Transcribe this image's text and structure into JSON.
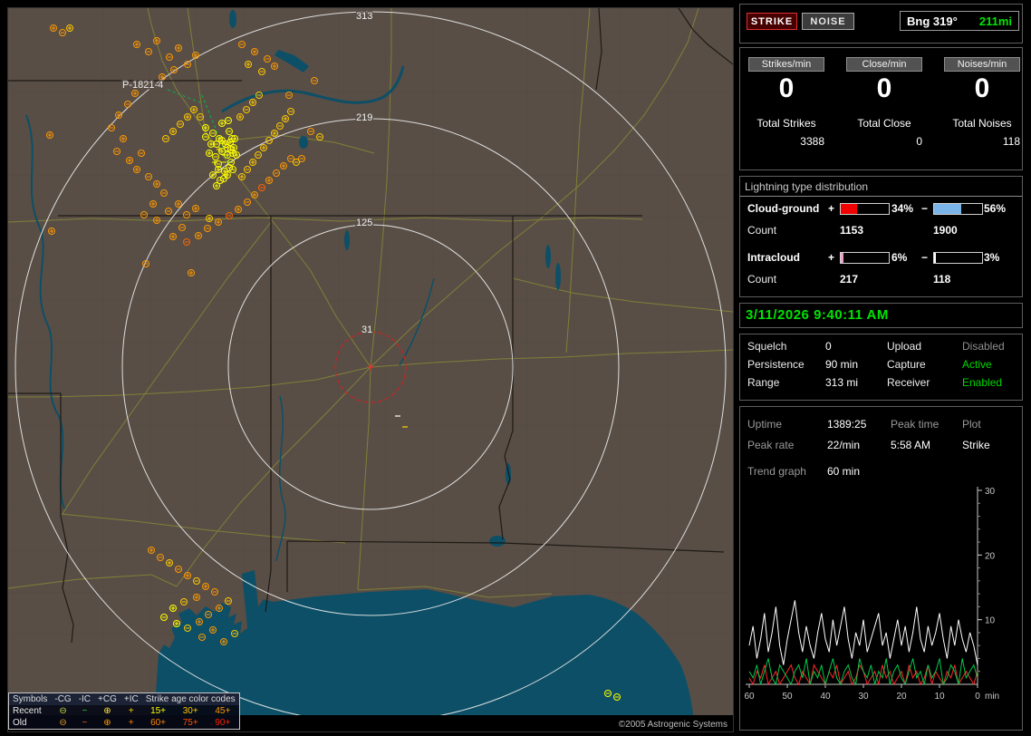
{
  "app": {
    "copyright": "©2005 Astrogenic Systems"
  },
  "map": {
    "station_label": "P-1821-4",
    "range_labels": [
      "313",
      "219",
      "125",
      "31"
    ],
    "strike_colors": [
      "#ffff00",
      "#ffc800",
      "#ff9800",
      "#ff6400"
    ],
    "strikes": [
      [
        218,
        132,
        0,
        "p"
      ],
      [
        226,
        138,
        0,
        "m"
      ],
      [
        233,
        144,
        0,
        "p"
      ],
      [
        240,
        150,
        0,
        "p"
      ],
      [
        247,
        144,
        0,
        "m"
      ],
      [
        236,
        158,
        0,
        "p"
      ],
      [
        229,
        164,
        0,
        "m"
      ],
      [
        242,
        162,
        0,
        "p"
      ],
      [
        249,
        154,
        0,
        "p"
      ],
      [
        224,
        150,
        0,
        "p"
      ],
      [
        232,
        172,
        0,
        "m"
      ],
      [
        239,
        180,
        0,
        "p"
      ],
      [
        246,
        170,
        0,
        "m"
      ],
      [
        252,
        162,
        0,
        "p"
      ],
      [
        226,
        184,
        0,
        "p"
      ],
      [
        234,
        190,
        0,
        "m"
      ],
      [
        242,
        184,
        0,
        "p"
      ],
      [
        248,
        178,
        0,
        "m"
      ],
      [
        230,
        196,
        0,
        "p"
      ],
      [
        238,
        188,
        0,
        "m"
      ],
      [
        222,
        160,
        0,
        "p"
      ],
      [
        244,
        136,
        0,
        "m"
      ],
      [
        250,
        144,
        0,
        "p"
      ],
      [
        218,
        142,
        0,
        "m"
      ],
      [
        236,
        127,
        0,
        "p"
      ],
      [
        243,
        124,
        0,
        "m"
      ],
      [
        230,
        150,
        0,
        "m"
      ],
      [
        236,
        146,
        0,
        "p"
      ],
      [
        242,
        154,
        0,
        "m"
      ],
      [
        248,
        160,
        0,
        "p"
      ],
      [
        233,
        156,
        0,
        "+"
      ],
      [
        239,
        162,
        0,
        "-"
      ],
      [
        245,
        148,
        0,
        "p"
      ],
      [
        228,
        170,
        0,
        "+"
      ],
      [
        244,
        176,
        0,
        "m"
      ],
      [
        238,
        170,
        0,
        "-"
      ],
      [
        232,
        178,
        0,
        "p"
      ],
      [
        246,
        156,
        0,
        "m"
      ],
      [
        205,
        112,
        1,
        "p"
      ],
      [
        212,
        120,
        1,
        "m"
      ],
      [
        198,
        120,
        1,
        "p"
      ],
      [
        190,
        128,
        1,
        "m"
      ],
      [
        182,
        136,
        1,
        "p"
      ],
      [
        174,
        144,
        1,
        "m"
      ],
      [
        256,
        120,
        1,
        "p"
      ],
      [
        263,
        112,
        1,
        "m"
      ],
      [
        270,
        104,
        1,
        "p"
      ],
      [
        277,
        96,
        1,
        "m"
      ],
      [
        258,
        186,
        1,
        "p"
      ],
      [
        264,
        178,
        1,
        "m"
      ],
      [
        270,
        170,
        1,
        "p"
      ],
      [
        276,
        162,
        1,
        "m"
      ],
      [
        282,
        154,
        1,
        "p"
      ],
      [
        288,
        146,
        1,
        "m"
      ],
      [
        294,
        138,
        1,
        "p"
      ],
      [
        300,
        130,
        1,
        "m"
      ],
      [
        306,
        122,
        1,
        "p"
      ],
      [
        312,
        114,
        1,
        "m"
      ],
      [
        265,
        62,
        1,
        "p"
      ],
      [
        280,
        70,
        1,
        "m"
      ],
      [
        344,
        142,
        1,
        "m"
      ],
      [
        222,
        232,
        1,
        "p"
      ],
      [
        318,
        170,
        1,
        "m"
      ],
      [
        142,
        40,
        2,
        "p"
      ],
      [
        155,
        48,
        2,
        "m"
      ],
      [
        164,
        36,
        2,
        "p"
      ],
      [
        178,
        54,
        2,
        "m"
      ],
      [
        188,
        44,
        2,
        "p"
      ],
      [
        198,
        62,
        2,
        "m"
      ],
      [
        207,
        52,
        2,
        "p"
      ],
      [
        183,
        68,
        2,
        "m"
      ],
      [
        170,
        76,
        2,
        "p"
      ],
      [
        152,
        84,
        2,
        "m"
      ],
      [
        140,
        94,
        2,
        "p"
      ],
      [
        132,
        106,
        2,
        "m"
      ],
      [
        122,
        118,
        2,
        "p"
      ],
      [
        114,
        132,
        2,
        "m"
      ],
      [
        127,
        144,
        2,
        "p"
      ],
      [
        120,
        158,
        2,
        "m"
      ],
      [
        134,
        168,
        2,
        "p"
      ],
      [
        147,
        160,
        2,
        "m"
      ],
      [
        142,
        178,
        2,
        "p"
      ],
      [
        155,
        186,
        2,
        "m"
      ],
      [
        164,
        194,
        2,
        "p"
      ],
      [
        172,
        204,
        2,
        "m"
      ],
      [
        160,
        216,
        2,
        "p"
      ],
      [
        150,
        228,
        2,
        "m"
      ],
      [
        164,
        234,
        2,
        "p"
      ],
      [
        177,
        224,
        2,
        "m"
      ],
      [
        188,
        216,
        2,
        "p"
      ],
      [
        197,
        228,
        2,
        "m"
      ],
      [
        207,
        221,
        2,
        "p"
      ],
      [
        192,
        242,
        2,
        "m"
      ],
      [
        258,
        40,
        2,
        "m"
      ],
      [
        272,
        48,
        2,
        "p"
      ],
      [
        286,
        56,
        2,
        "m"
      ],
      [
        294,
        64,
        2,
        "p"
      ],
      [
        310,
        96,
        2,
        "m"
      ],
      [
        182,
        252,
        2,
        "p"
      ],
      [
        197,
        258,
        3,
        "m"
      ],
      [
        210,
        251,
        2,
        "p"
      ],
      [
        220,
        243,
        2,
        "m"
      ],
      [
        232,
        236,
        2,
        "p"
      ],
      [
        244,
        229,
        3,
        "m"
      ],
      [
        254,
        222,
        2,
        "p"
      ],
      [
        264,
        214,
        2,
        "m"
      ],
      [
        272,
        206,
        2,
        "p"
      ],
      [
        280,
        198,
        3,
        "m"
      ],
      [
        288,
        190,
        2,
        "p"
      ],
      [
        296,
        182,
        2,
        "m"
      ],
      [
        304,
        174,
        2,
        "p"
      ],
      [
        312,
        166,
        2,
        "m"
      ],
      [
        50,
        22,
        2,
        "p"
      ],
      [
        60,
        27,
        2,
        "m"
      ],
      [
        68,
        22,
        1,
        "p"
      ],
      [
        338,
        80,
        2,
        "m"
      ],
      [
        324,
        166,
        2,
        "m"
      ],
      [
        334,
        136,
        2,
        "m"
      ],
      [
        46,
        140,
        2,
        "p"
      ],
      [
        48,
        246,
        2,
        "p"
      ],
      [
        152,
        282,
        2,
        "m"
      ],
      [
        202,
        292,
        2,
        "p"
      ],
      [
        158,
        598,
        2,
        "p"
      ],
      [
        168,
        606,
        2,
        "m"
      ],
      [
        178,
        612,
        1,
        "p"
      ],
      [
        188,
        619,
        2,
        "m"
      ],
      [
        198,
        626,
        2,
        "p"
      ],
      [
        208,
        632,
        1,
        "m"
      ],
      [
        218,
        638,
        2,
        "p"
      ],
      [
        228,
        644,
        2,
        "m"
      ],
      [
        208,
        650,
        2,
        "p"
      ],
      [
        194,
        655,
        1,
        "m"
      ],
      [
        182,
        662,
        0,
        "p"
      ],
      [
        172,
        672,
        0,
        "m"
      ],
      [
        186,
        679,
        0,
        "p"
      ],
      [
        198,
        684,
        1,
        "m"
      ],
      [
        211,
        677,
        2,
        "p"
      ],
      [
        221,
        669,
        2,
        "m"
      ],
      [
        233,
        662,
        2,
        "p"
      ],
      [
        243,
        654,
        1,
        "m"
      ],
      [
        226,
        686,
        2,
        "p"
      ],
      [
        214,
        694,
        2,
        "m"
      ],
      [
        238,
        699,
        2,
        "p"
      ],
      [
        250,
        690,
        1,
        "m"
      ],
      [
        662,
        756,
        0,
        "m"
      ],
      [
        672,
        760,
        0,
        "m"
      ]
    ],
    "legend": {
      "symbols_title": "Symbols",
      "type_headers": [
        "-CG",
        "-IC",
        "+CG",
        "+IC"
      ],
      "age_title": "Strike age color codes",
      "rows": [
        {
          "label": "Recent",
          "symbols": [
            "⊖",
            "−",
            "⊕",
            "+"
          ],
          "symbol_colors": [
            "#c6d93f",
            "#2fc83f",
            "#ffe23f",
            "#ffd400"
          ],
          "ages": [
            {
              "text": "15+",
              "color": "#ffff00"
            },
            {
              "text": "30+",
              "color": "#ffc800"
            },
            {
              "text": "45+",
              "color": "#ff9800"
            }
          ]
        },
        {
          "label": "Old",
          "symbols": [
            "⊖",
            "−",
            "⊕",
            "+"
          ],
          "symbol_colors": [
            "#e89a20",
            "#e06020",
            "#ff9800",
            "#ff8400"
          ],
          "ages": [
            {
              "text": "60+",
              "color": "#ff8400"
            },
            {
              "text": "75+",
              "color": "#ff5000"
            },
            {
              "text": "90+",
              "color": "#ff1e00"
            }
          ]
        }
      ]
    }
  },
  "panel": {
    "buttons": {
      "strike": "STRIKE",
      "noise": "NOISE"
    },
    "bearing": {
      "label": "Bng 319°",
      "distance": "211mi"
    },
    "rates": [
      {
        "label": "Strikes/min",
        "value": "0",
        "total_label": "Total Strikes",
        "total_value": "3388"
      },
      {
        "label": "Close/min",
        "value": "0",
        "total_label": "Total Close",
        "total_value": "0"
      },
      {
        "label": "Noises/min",
        "value": "0",
        "total_label": "Total Noises",
        "total_value": "118"
      }
    ],
    "distribution": {
      "title": "Lightning type distribution",
      "plus_sign": "+",
      "minus_sign": "−",
      "rows": [
        {
          "label": "Cloud-ground",
          "plus_fill": 34,
          "plus_pct": "34%",
          "plus_color": "#f00000",
          "minus_fill": 56,
          "minus_pct": "56%",
          "minus_color": "#7ab4e8",
          "count_label": "Count",
          "plus_count": "1153",
          "minus_count": "1900"
        },
        {
          "label": "Intracloud",
          "plus_fill": 6,
          "plus_pct": "6%",
          "plus_color": "#f0a0c8",
          "minus_fill": 3,
          "minus_pct": "3%",
          "minus_color": "#ffffff",
          "count_label": "Count",
          "plus_count": "217",
          "minus_count": "118"
        }
      ]
    },
    "clock": "3/11/2026 9:40:11 AM",
    "status_rows": [
      {
        "label": "Squelch",
        "value": "0",
        "label2": "Upload",
        "value2": "Disabled",
        "value2_color": "#8f8f8f"
      },
      {
        "label": "Persistence",
        "value": "90 min",
        "label2": "Capture",
        "value2": "Active",
        "value2_color": "#00d800"
      },
      {
        "label": "Range",
        "value": "313 mi",
        "label2": "Receiver",
        "value2": "Enabled",
        "value2_color": "#00d800"
      }
    ],
    "stats": {
      "rows": [
        {
          "c1": "Uptime",
          "c2": "1389:25",
          "c3": "Peak time",
          "c4": "Plot"
        },
        {
          "c1": "Peak rate",
          "c2": "22/min",
          "c3": "5:58 AM",
          "c4": "Strike"
        }
      ],
      "trend_label": "Trend graph",
      "trend_value": "60 min"
    }
  },
  "chart_data": {
    "type": "line",
    "title": "Trend graph",
    "window_label": "60 min",
    "x_label": "min",
    "x_ticks": [
      60,
      50,
      40,
      30,
      20,
      10,
      0
    ],
    "y_ticks": [
      10,
      20,
      30
    ],
    "ylim": [
      0,
      30
    ],
    "xlim_minutes_ago": [
      60,
      0
    ],
    "legend_position": "none",
    "series": [
      {
        "name": "strikes_per_min",
        "color": "#ffffff",
        "values": [
          6,
          9,
          4,
          7,
          11,
          5,
          8,
          12,
          6,
          3,
          7,
          10,
          13,
          8,
          5,
          9,
          6,
          4,
          8,
          11,
          7,
          5,
          10,
          6,
          9,
          12,
          7,
          4,
          8,
          6,
          10,
          5,
          7,
          9,
          11,
          6,
          8,
          4,
          7,
          10,
          6,
          9,
          5,
          8,
          12,
          7,
          5,
          9,
          6,
          8,
          11,
          7,
          4,
          9,
          6,
          10,
          7,
          5,
          8,
          6,
          3
        ]
      },
      {
        "name": "close_per_min",
        "color": "#ff2828",
        "values": [
          1,
          0,
          2,
          1,
          3,
          0,
          1,
          2,
          0,
          1,
          2,
          3,
          1,
          0,
          2,
          1,
          0,
          3,
          2,
          1,
          0,
          2,
          1,
          3,
          0,
          1,
          2,
          0,
          1,
          3,
          2,
          0,
          1,
          2,
          0,
          3,
          1,
          2,
          0,
          1,
          2,
          0,
          3,
          1,
          2,
          0,
          1,
          3,
          0,
          2,
          1,
          0,
          2,
          1,
          3,
          0,
          1,
          2,
          1,
          0,
          2
        ]
      },
      {
        "name": "noises_per_min",
        "color": "#00c84c",
        "values": [
          2,
          1,
          3,
          0,
          2,
          4,
          1,
          0,
          3,
          2,
          1,
          0,
          2,
          3,
          1,
          4,
          0,
          2,
          1,
          3,
          0,
          2,
          4,
          1,
          0,
          2,
          3,
          1,
          0,
          4,
          2,
          1,
          3,
          0,
          2,
          1,
          4,
          0,
          2,
          3,
          1,
          0,
          2,
          4,
          1,
          2,
          0,
          3,
          1,
          2,
          4,
          0,
          1,
          3,
          2,
          0,
          4,
          1,
          2,
          3,
          1
        ]
      }
    ]
  }
}
